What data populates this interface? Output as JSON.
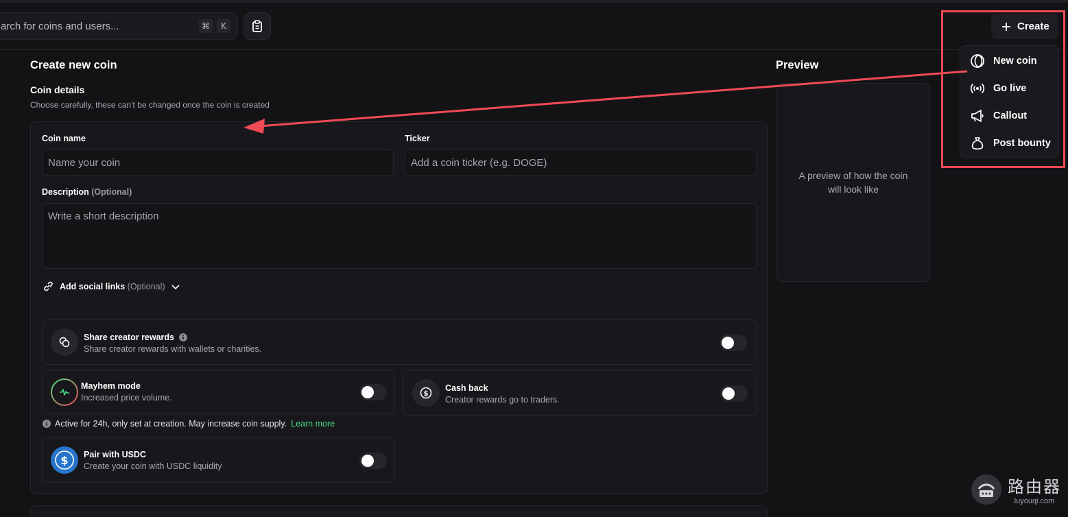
{
  "search": {
    "placeholder": "Search for coins and users...",
    "visible_text": "arch for coins and users...",
    "shortcut_cmd": "⌘",
    "shortcut_key": "K"
  },
  "header": {
    "create_label": "Create"
  },
  "create_menu": {
    "items": [
      {
        "label": "New coin",
        "icon": "coin-icon"
      },
      {
        "label": "Go live",
        "icon": "broadcast-icon"
      },
      {
        "label": "Callout",
        "icon": "megaphone-icon"
      },
      {
        "label": "Post bounty",
        "icon": "money-bag-icon"
      }
    ]
  },
  "form": {
    "page_title": "Create new coin",
    "section_title": "Coin details",
    "section_subtitle": "Choose carefully, these can't be changed once the coin is created",
    "coin_name": {
      "label": "Coin name",
      "placeholder": "Name your coin",
      "value": ""
    },
    "ticker": {
      "label": "Ticker",
      "placeholder": "Add a coin ticker (e.g. DOGE)",
      "value": ""
    },
    "description": {
      "label": "Description",
      "optional": "(Optional)",
      "placeholder": "Write a short description",
      "value": ""
    },
    "social_links": {
      "label": "Add social links",
      "optional": "(Optional)"
    },
    "share_rewards": {
      "title": "Share creator rewards",
      "desc": "Share creator rewards with wallets or charities.",
      "enabled": false
    },
    "mayhem": {
      "title": "Mayhem mode",
      "desc": "Increased price volume.",
      "enabled": false
    },
    "cashback": {
      "title": "Cash back",
      "desc": "Creator rewards go to traders.",
      "enabled": false
    },
    "notice": {
      "text": "Active for 24h, only set at creation. May increase coin supply.",
      "link": "Learn more"
    },
    "usdc": {
      "title": "Pair with USDC",
      "desc": "Create your coin with USDC liquidity",
      "enabled": false
    }
  },
  "preview": {
    "title": "Preview",
    "placeholder_text": "A preview of how the coin will look like"
  },
  "watermark": {
    "brand": "路由器",
    "url": "luyouqi.com"
  },
  "colors": {
    "background": "#131316",
    "card": "#18181c",
    "annotation_red": "#f04a55",
    "link_green": "#4ade80",
    "usdc_blue": "#2775ca"
  }
}
